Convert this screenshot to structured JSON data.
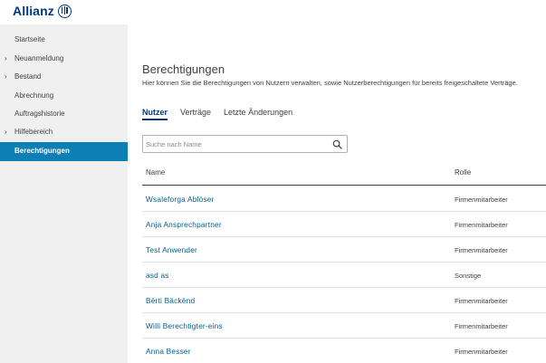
{
  "brand": {
    "logo_text": "Allianz"
  },
  "sidebar": {
    "items": [
      {
        "label": "Startseite",
        "has_children": false,
        "active": false
      },
      {
        "label": "Neuanmeldung",
        "has_children": true,
        "active": false
      },
      {
        "label": "Bestand",
        "has_children": true,
        "active": false
      },
      {
        "label": "Abrechnung",
        "has_children": false,
        "active": false
      },
      {
        "label": "Auftragshistorie",
        "has_children": false,
        "active": false
      },
      {
        "label": "Hilfebereich",
        "has_children": true,
        "active": false
      },
      {
        "label": "Berechtigungen",
        "has_children": false,
        "active": true
      }
    ]
  },
  "page": {
    "title": "Berechtigungen",
    "subtitle": "Hier können Sie die Berechtigungen von Nutzern verwalten, sowie Nutzerberechtigungen für bereits freigeschaltete Verträge."
  },
  "tabs": [
    {
      "label": "Nutzer",
      "active": true
    },
    {
      "label": "Verträge",
      "active": false
    },
    {
      "label": "Letzte Änderungen",
      "active": false
    }
  ],
  "search": {
    "placeholder": "Suche nach Name",
    "value": ""
  },
  "table": {
    "columns": {
      "name": "Name",
      "role": "Rolle"
    },
    "rows": [
      {
        "name": "Wsaleforga Ablöser",
        "role": "Firmenmitarbeiter"
      },
      {
        "name": "Anja Ansprechpartner",
        "role": "Firmenmitarbeiter"
      },
      {
        "name": "Test Anwender",
        "role": "Firmenmitarbeiter"
      },
      {
        "name": "asd as",
        "role": "Sonstige"
      },
      {
        "name": "Bërti Bäckënd",
        "role": "Firmenmitarbeiter"
      },
      {
        "name": "Willi Berechtigter-eins",
        "role": "Firmenmitarbeiter"
      },
      {
        "name": "Anna Besser",
        "role": "Firmenmitarbeiter"
      }
    ]
  },
  "colors": {
    "brand_blue": "#003781",
    "link_blue": "#006192",
    "active_nav": "#0e7fb5",
    "sidebar_bg": "#f0f0f0"
  }
}
